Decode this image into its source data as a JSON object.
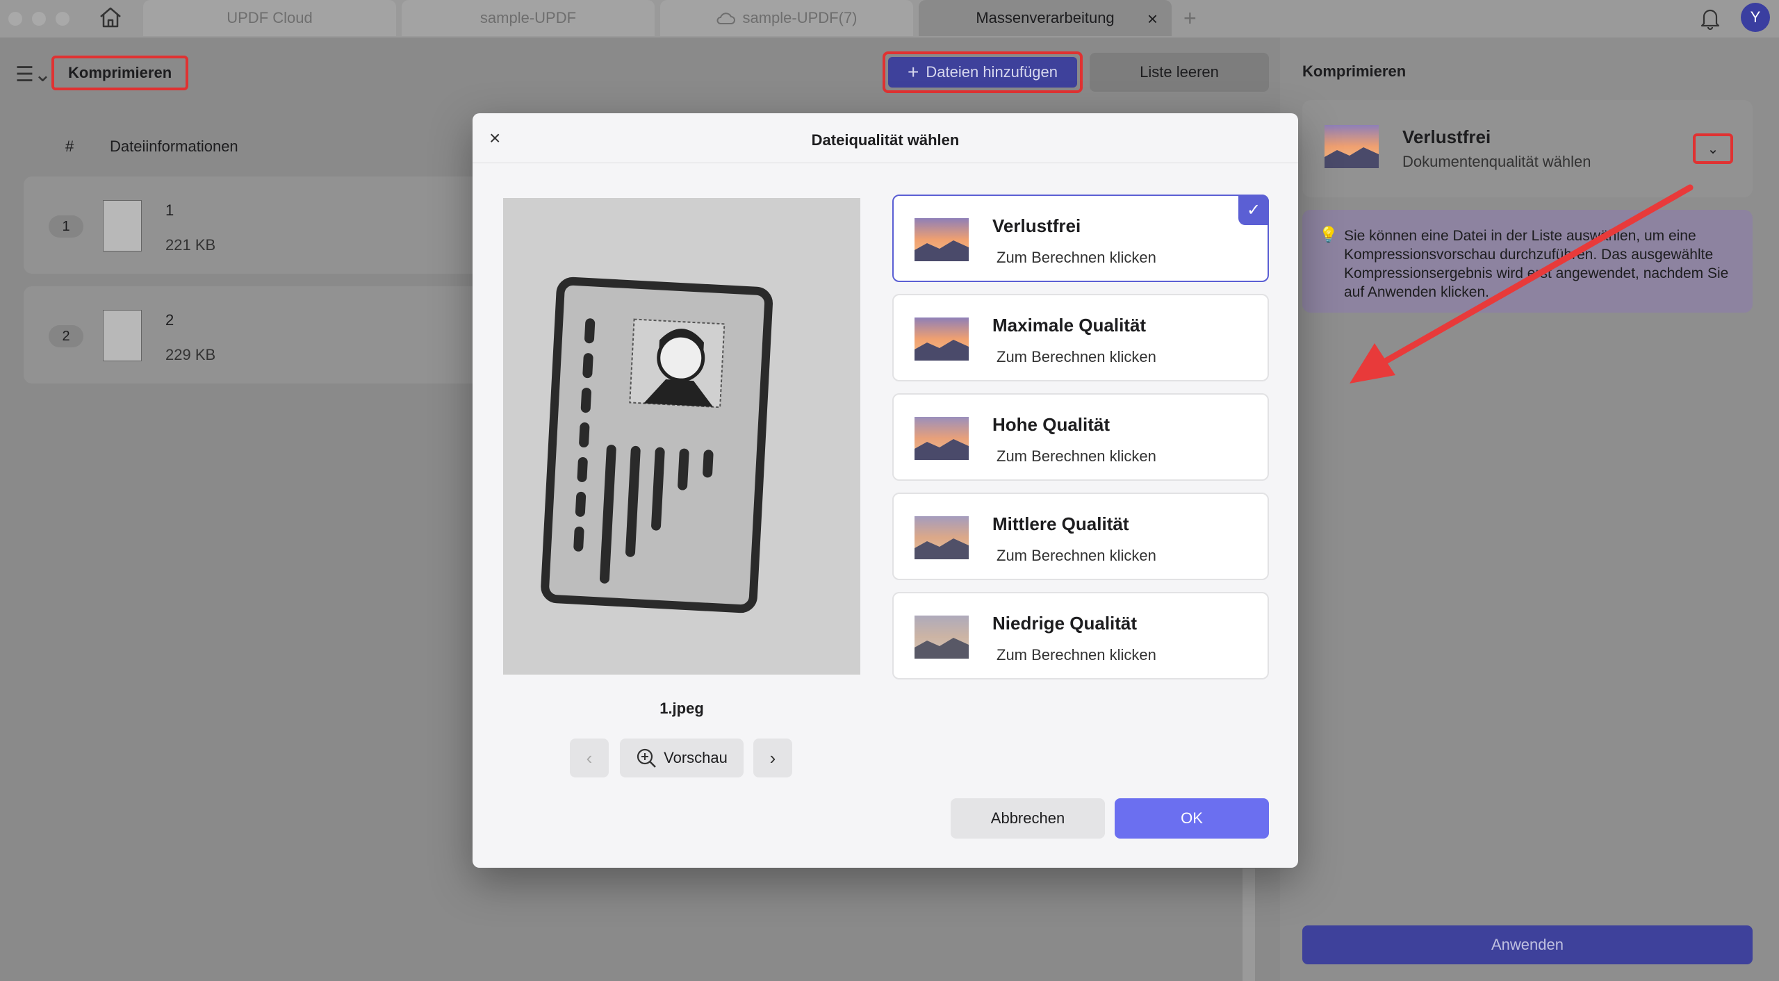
{
  "titlebar": {
    "tabs": [
      {
        "label": "UPDF Cloud"
      },
      {
        "label": "sample-UPDF"
      },
      {
        "label": "sample-UPDF(7)"
      },
      {
        "label": "Massenverarbeitung"
      }
    ],
    "close_glyph": "×",
    "add_glyph": "+",
    "avatar_letter": "Y"
  },
  "toolbar": {
    "mode_label": "Komprimieren",
    "add_files_label": "Dateien hinzufügen",
    "clear_list_label": "Liste leeren"
  },
  "file_list": {
    "col_hash": "#",
    "col_info": "Dateiinformationen",
    "rows": [
      {
        "num": "1",
        "name": "1",
        "size": "221 KB"
      },
      {
        "num": "2",
        "name": "2",
        "size": "229 KB"
      }
    ]
  },
  "right_panel": {
    "title": "Komprimieren",
    "selected_quality": "Verlustfrei",
    "selected_sub": "Dokumentenqualität wählen",
    "hint": "Sie können eine Datei in der Liste auswählen, um eine Kompressionsvorschau durchzuführen. Das ausgewählte Kompressionsergebnis wird erst angewendet, nachdem Sie auf Anwenden klicken.",
    "apply_label": "Anwenden"
  },
  "modal": {
    "title": "Dateiqualität wählen",
    "close_glyph": "×",
    "preview_filename": "1.jpeg",
    "zoom_label": "Vorschau",
    "options": [
      {
        "title": "Verlustfrei",
        "sub": "Zum Berechnen klicken",
        "selected": true
      },
      {
        "title": "Maximale Qualität",
        "sub": "Zum Berechnen klicken",
        "selected": false
      },
      {
        "title": "Hohe Qualität",
        "sub": "Zum Berechnen klicken",
        "selected": false
      },
      {
        "title": "Mittlere Qualität",
        "sub": "Zum Berechnen klicken",
        "selected": false
      },
      {
        "title": "Niedrige Qualität",
        "sub": "Zum Berechnen klicken",
        "selected": false
      }
    ],
    "cancel_label": "Abbrechen",
    "ok_label": "OK"
  },
  "colors": {
    "accent": "#6b6ff0",
    "highlight_red": "#e03232"
  }
}
